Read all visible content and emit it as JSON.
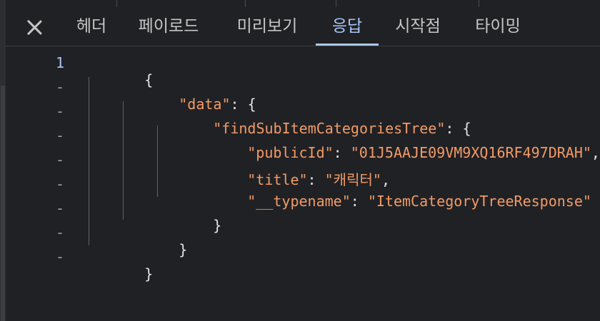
{
  "tabs": {
    "close_label": "close",
    "items": [
      {
        "label": "헤더",
        "active": false
      },
      {
        "label": "페이로드",
        "active": false
      },
      {
        "label": "미리보기",
        "active": false
      },
      {
        "label": "응답",
        "active": true
      },
      {
        "label": "시작점",
        "active": false
      },
      {
        "label": "타이밍",
        "active": false
      }
    ]
  },
  "response": {
    "line_numbers": [
      "1",
      "-",
      "-",
      "-",
      "-",
      "-",
      "-",
      "-",
      "-"
    ],
    "open_root": "{",
    "data_key": "\"data\"",
    "data_open": ": {",
    "fn_key": "\"findSubItemCategoriesTree\"",
    "fn_open": ": {",
    "public_id_key": "\"publicId\"",
    "public_id_value": "\"01J5AAJE09VM9XQ16RF497DRAH\"",
    "title_key": "\"title\"",
    "title_value": "\"캐릭터\"",
    "typename_key": "\"__typename\"",
    "typename_value": "\"ItemCategoryTreeResponse\"",
    "colon": ": ",
    "comma": ",",
    "close_fn": "}",
    "close_data": "}",
    "close_root": "}"
  },
  "colors": {
    "background": "#202124",
    "string": "#f29b68",
    "active_tab": "#a8c7fa",
    "text": "#c4c7c5"
  }
}
